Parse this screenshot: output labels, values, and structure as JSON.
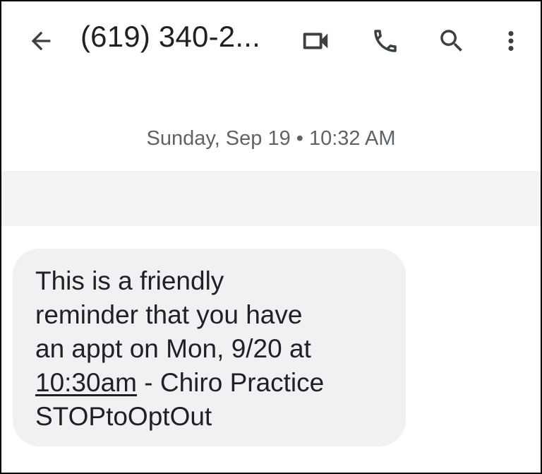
{
  "header": {
    "title": "(619) 340-2...",
    "icons": {
      "back": "arrow-back-icon",
      "video": "video-call-icon",
      "phone": "phone-icon",
      "search": "search-icon",
      "more": "more-vert-icon"
    }
  },
  "conversation": {
    "timestamp": "Sunday, Sep 19 • 10:32 AM",
    "message": {
      "line1": "This is a friendly",
      "line2": "reminder that you have",
      "line3": "an appt on Mon, 9/20 at",
      "link_text": "10:30am",
      "line4_rest": " - Chiro Practice",
      "line5": "STOPtoOptOut"
    }
  },
  "colors": {
    "text_primary": "#202124",
    "text_secondary": "#5f6368",
    "bubble_bg": "#eff1f3",
    "band_bg": "#f1f3f4",
    "frame_border": "#000000"
  }
}
